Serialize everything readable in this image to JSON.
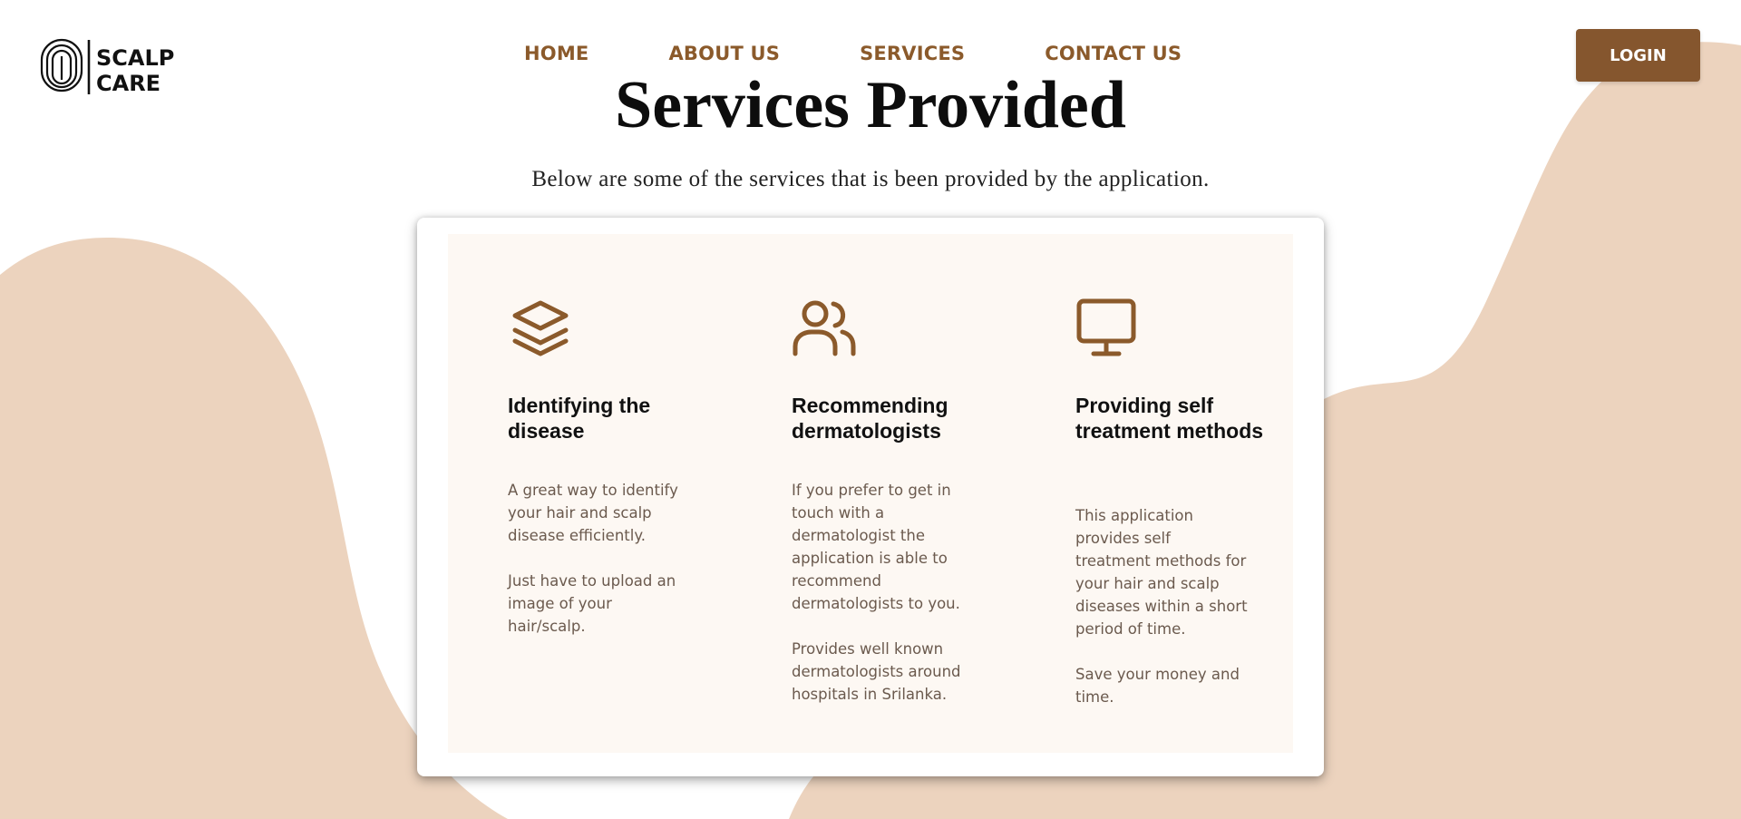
{
  "brand": {
    "logo_line1": "SCALP",
    "logo_line2": "CARE"
  },
  "nav": {
    "items": [
      {
        "label": "HOME"
      },
      {
        "label": "ABOUT US"
      },
      {
        "label": "SERVICES"
      },
      {
        "label": "CONTACT US"
      }
    ],
    "login_label": "LOGIN"
  },
  "colors": {
    "accent": "#85562e",
    "nav_text": "#8b5a2b",
    "background_blob": "#ecd3be",
    "card_inner": "#fdf8f3"
  },
  "page": {
    "title": "Services Provided",
    "subtitle": "Below are some of the services that is been provided by the application."
  },
  "services": [
    {
      "icon": "layers-icon",
      "title": "Identifying the disease",
      "paragraphs": [
        "A great way to identify your hair and scalp disease efficiently.",
        "Just have to upload an image of your hair/scalp."
      ]
    },
    {
      "icon": "users-icon",
      "title": "Recommending dermatologists",
      "paragraphs": [
        "If you prefer to get in touch with a dermatologist the application is able to recommend dermatologists to you.",
        "Provides well known dermatologists around hospitals in Srilanka."
      ]
    },
    {
      "icon": "monitor-icon",
      "title": "Providing self treatment methods",
      "paragraphs": [
        "This application provides self treatment methods for your hair and scalp diseases within a short period of time.",
        "Save your money and time."
      ]
    }
  ]
}
